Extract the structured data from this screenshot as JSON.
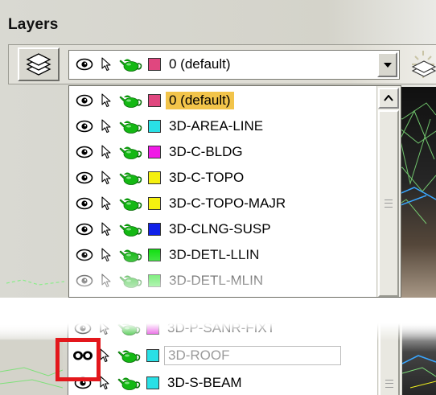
{
  "palette": {
    "title": "Layers"
  },
  "current_layer": {
    "name": "0 (default)",
    "color": "#e0477f"
  },
  "layers": [
    {
      "name": "0 (default)",
      "color": "#e0477f",
      "selected": true
    },
    {
      "name": "3D-AREA-LINE",
      "color": "#29e0e6",
      "selected": false
    },
    {
      "name": "3D-C-BLDG",
      "color": "#f01ae6",
      "selected": false
    },
    {
      "name": "3D-C-TOPO",
      "color": "#f5f010",
      "selected": false
    },
    {
      "name": "3D-C-TOPO-MAJR",
      "color": "#f5f010",
      "selected": false
    },
    {
      "name": "3D-CLNG-SUSP",
      "color": "#1020e8",
      "selected": false
    },
    {
      "name": "3D-DETL-LLIN",
      "color": "#19e019",
      "selected": false
    },
    {
      "name": "3D-DETL-MLIN",
      "color": "#19e019",
      "selected": false
    }
  ],
  "detail_layers": [
    {
      "name": "3D-P-SANR-FIXT",
      "color": "#e01ad8",
      "hidden": false
    },
    {
      "name": "3D-ROOF",
      "color": "#29e0e6",
      "hidden": true
    },
    {
      "name": "3D-S-BEAM",
      "color": "#29e0e6",
      "hidden": false
    }
  ],
  "icons": {
    "layer_manager": "layers-stack-icon",
    "visible": "eye-icon",
    "hidden": "closed-eye-icon",
    "selectable": "cursor-arrow-icon",
    "render": "teapot-icon",
    "dropdown": "chevron-down-icon",
    "scroll_up": "scroll-up-arrow-icon",
    "extra_tool": "sun-icon"
  },
  "highlight_color": "#e3171c"
}
